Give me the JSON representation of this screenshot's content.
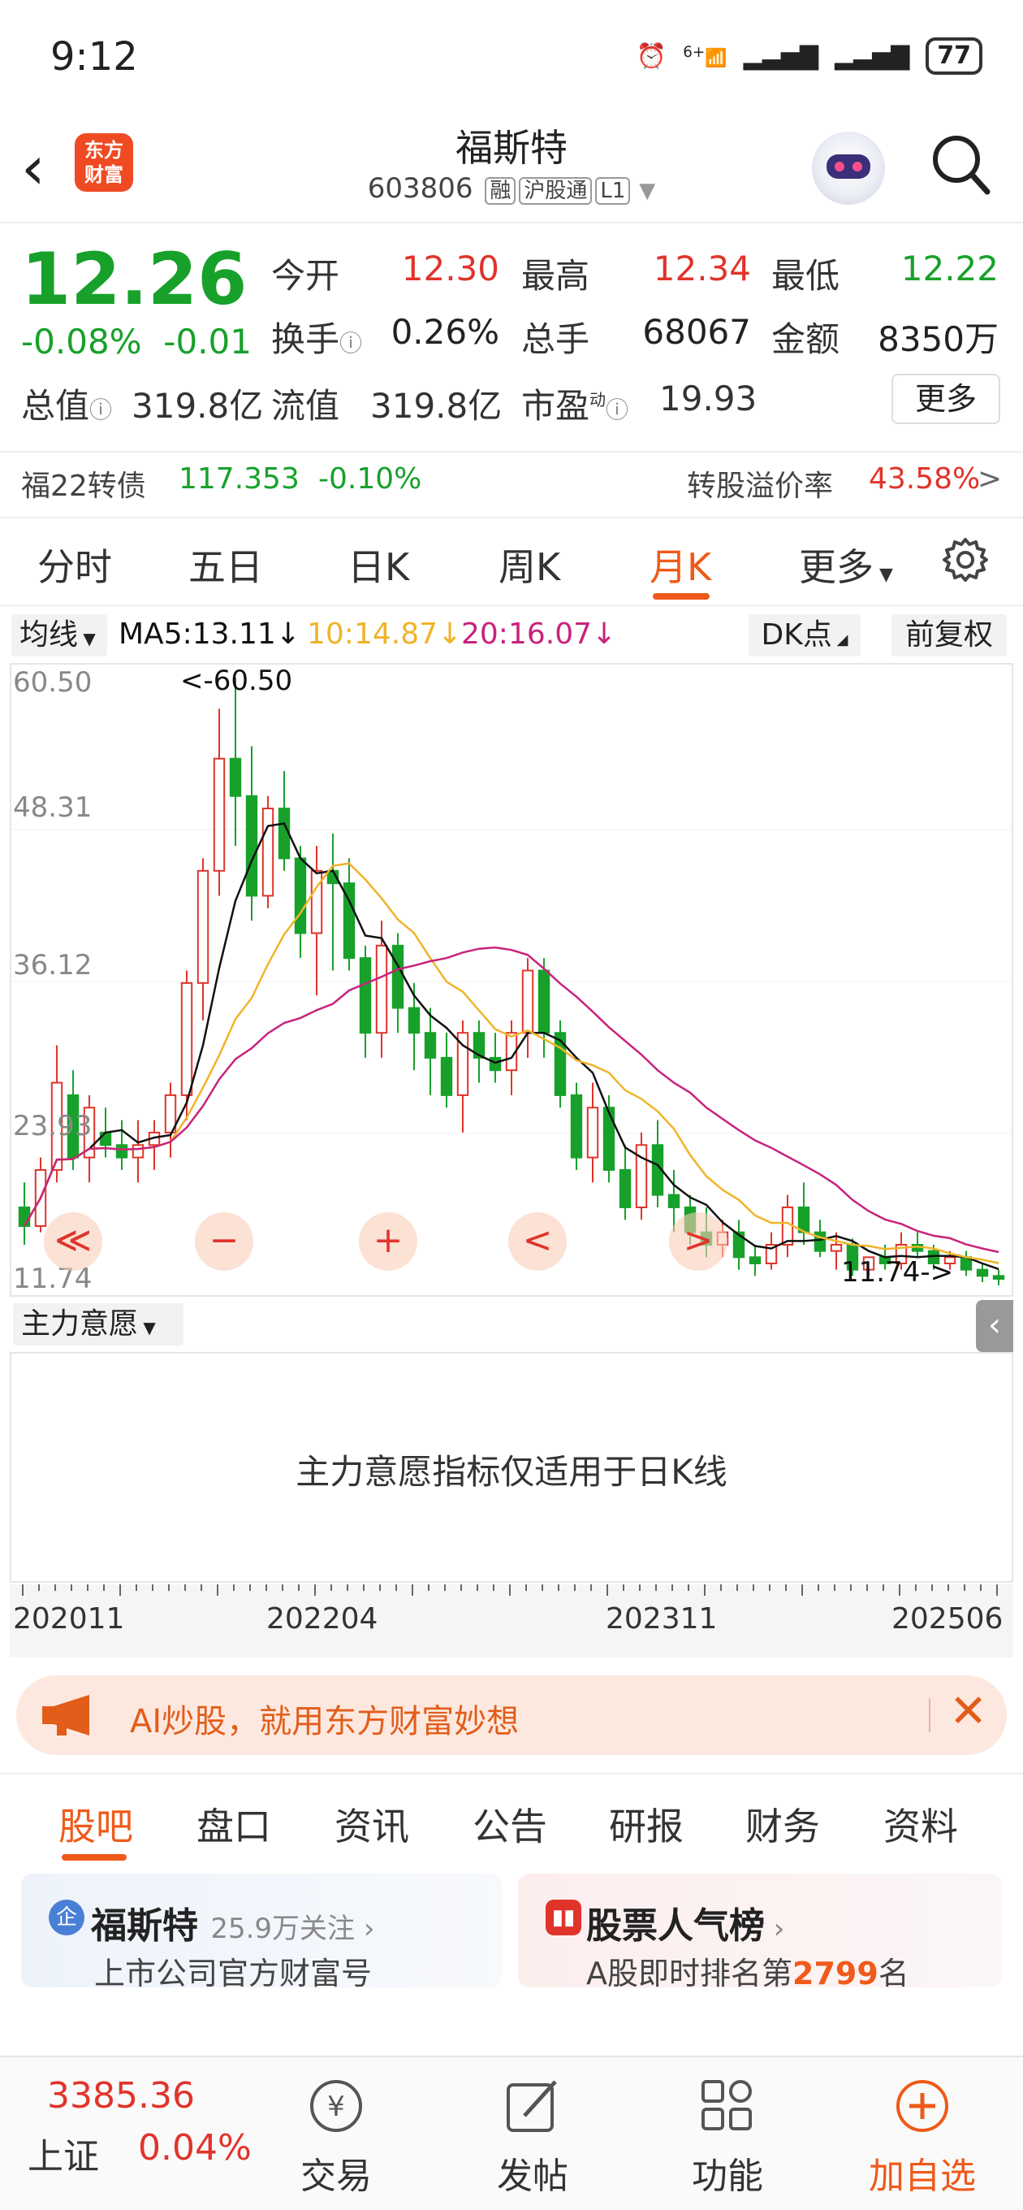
{
  "status": {
    "time": "9:12",
    "battery": "77",
    "net": "6+"
  },
  "header": {
    "logo": "东方财富",
    "name": "福斯特",
    "code": "603806",
    "tags": [
      "融",
      "沪股通",
      "L1"
    ]
  },
  "quote": {
    "price": "12.26",
    "change_pct": "-0.08%",
    "change": "-0.01",
    "open_label": "今开",
    "open": "12.30",
    "high_label": "最高",
    "high": "12.34",
    "low_label": "最低",
    "low": "12.22",
    "turnover_label": "换手",
    "turnover": "0.26%",
    "volume_label": "总手",
    "volume": "68067",
    "amount_label": "金额",
    "amount": "8350万",
    "mktcap_label": "总值",
    "mktcap": "319.8亿",
    "float_label": "流值",
    "float": "319.8亿",
    "pe_label": "市盈",
    "pe_sup": "动",
    "pe": "19.93",
    "more": "更多"
  },
  "bond": {
    "name": "福22转债",
    "price": "117.353",
    "pct": "-0.10%",
    "premium_label": "转股溢价率",
    "premium": "43.58%",
    "arrow": ">"
  },
  "ktabs": [
    "分时",
    "五日",
    "日K",
    "周K",
    "月K",
    "更多"
  ],
  "ktab_active": "月K",
  "ma": {
    "selector": "均线",
    "ma5": "MA5:13.11",
    "ma10": "10:14.87",
    "ma20": "20:16.07",
    "dk": "DK点",
    "fq": "前复权"
  },
  "chart_axis": {
    "top": "60.50",
    "l2": "48.31",
    "l3": "36.12",
    "l4": "23.93",
    "bottom": "11.74",
    "max_note": "<-60.50",
    "min_note": "11.74->"
  },
  "chart_data": {
    "type": "candlestick",
    "x_start": "202011",
    "x_end": "202506",
    "ylim": [
      11.74,
      60.5
    ],
    "ohlc": [
      [
        18,
        20,
        15,
        16.5
      ],
      [
        16.5,
        22,
        16,
        21
      ],
      [
        21,
        31,
        20,
        28
      ],
      [
        27,
        29,
        21,
        22
      ],
      [
        22,
        27,
        20,
        26
      ],
      [
        24,
        26,
        22,
        23
      ],
      [
        23,
        25,
        21,
        22
      ],
      [
        22,
        25,
        20,
        23
      ],
      [
        23,
        25,
        21,
        24
      ],
      [
        24,
        28,
        22,
        27
      ],
      [
        27,
        37,
        25,
        36
      ],
      [
        36,
        46,
        33,
        45
      ],
      [
        45,
        58,
        43,
        54
      ],
      [
        54,
        60.5,
        47,
        51
      ],
      [
        51,
        55,
        41,
        43
      ],
      [
        43,
        51,
        42,
        50
      ],
      [
        50,
        53,
        45,
        46
      ],
      [
        46,
        47,
        38,
        40
      ],
      [
        40,
        47,
        35,
        45
      ],
      [
        45,
        48,
        37,
        44
      ],
      [
        44,
        46,
        37,
        38
      ],
      [
        38,
        39,
        30,
        32
      ],
      [
        32,
        41,
        30,
        39
      ],
      [
        39,
        40,
        32,
        34
      ],
      [
        34,
        36,
        29,
        32
      ],
      [
        32,
        34,
        27,
        30
      ],
      [
        30,
        32,
        26,
        27
      ],
      [
        27,
        33,
        24,
        32
      ],
      [
        32,
        33,
        28,
        30
      ],
      [
        30,
        32,
        28,
        29
      ],
      [
        29,
        33,
        27,
        32
      ],
      [
        32,
        38,
        30,
        37
      ],
      [
        37,
        38,
        30,
        32
      ],
      [
        32,
        33,
        26,
        27
      ],
      [
        27,
        28,
        21,
        22
      ],
      [
        22,
        28,
        20,
        26
      ],
      [
        26,
        27,
        20,
        21
      ],
      [
        21,
        23,
        17,
        18
      ],
      [
        18,
        24,
        17,
        23
      ],
      [
        23,
        25,
        18,
        19
      ],
      [
        19,
        21,
        16,
        18
      ],
      [
        18,
        19,
        15,
        16
      ],
      [
        16,
        18,
        14,
        15
      ],
      [
        15,
        17,
        14,
        16
      ],
      [
        16,
        17,
        13,
        14
      ],
      [
        14,
        15,
        12.5,
        13.5
      ],
      [
        13.5,
        16,
        13,
        15
      ],
      [
        15,
        19,
        14,
        18
      ],
      [
        18,
        20,
        15,
        16
      ],
      [
        16,
        17,
        14,
        14.5
      ],
      [
        14.5,
        16,
        13,
        15
      ],
      [
        15,
        15.5,
        12.5,
        13
      ],
      [
        13,
        14,
        12.5,
        14
      ],
      [
        14,
        15,
        13,
        13.5
      ],
      [
        13.5,
        16,
        13,
        15
      ],
      [
        15,
        16,
        14,
        14.5
      ],
      [
        14.5,
        15,
        13,
        13.5
      ],
      [
        13.5,
        14.5,
        13,
        14
      ],
      [
        14,
        14.5,
        12.5,
        13
      ],
      [
        13,
        13.5,
        12,
        12.5
      ],
      [
        12.5,
        13,
        11.74,
        12.26
      ]
    ],
    "series": [
      {
        "name": "MA5"
      },
      {
        "name": "MA10"
      },
      {
        "name": "MA20"
      }
    ]
  },
  "chart_ctrl": {
    "prev": "≪",
    "minus": "−",
    "plus": "+",
    "left": "<",
    "right": ">"
  },
  "indicator": {
    "selector": "主力意愿",
    "message": "主力意愿指标仅适用于日K线"
  },
  "xaxis": {
    "a": "202011",
    "b": "202204",
    "c": "202311",
    "d": "202506"
  },
  "banner": {
    "text": "AI炒股，就用东方财富妙想"
  },
  "ctabs": [
    "股吧",
    "盘口",
    "资讯",
    "公告",
    "研报",
    "财务",
    "资料"
  ],
  "cards": {
    "left": {
      "badge": "企",
      "title": "福斯特",
      "follow": "25.9万关注",
      "sub": "上市公司官方财富号"
    },
    "right": {
      "title": "股票人气榜",
      "sub_a": "A股即时排名第",
      "rank": "2799",
      "sub_b": "名"
    }
  },
  "bottom": {
    "index_value": "3385.36",
    "index_name": "上证",
    "index_pct": "0.04%",
    "trade": "交易",
    "post": "发帖",
    "func": "功能",
    "add": "加自选"
  },
  "colors": {
    "up": "#e0342b",
    "down": "#17a12b",
    "accent": "#ef5a1a",
    "ma5": "#111111",
    "ma10": "#f0b429",
    "ma20": "#c8237b"
  }
}
